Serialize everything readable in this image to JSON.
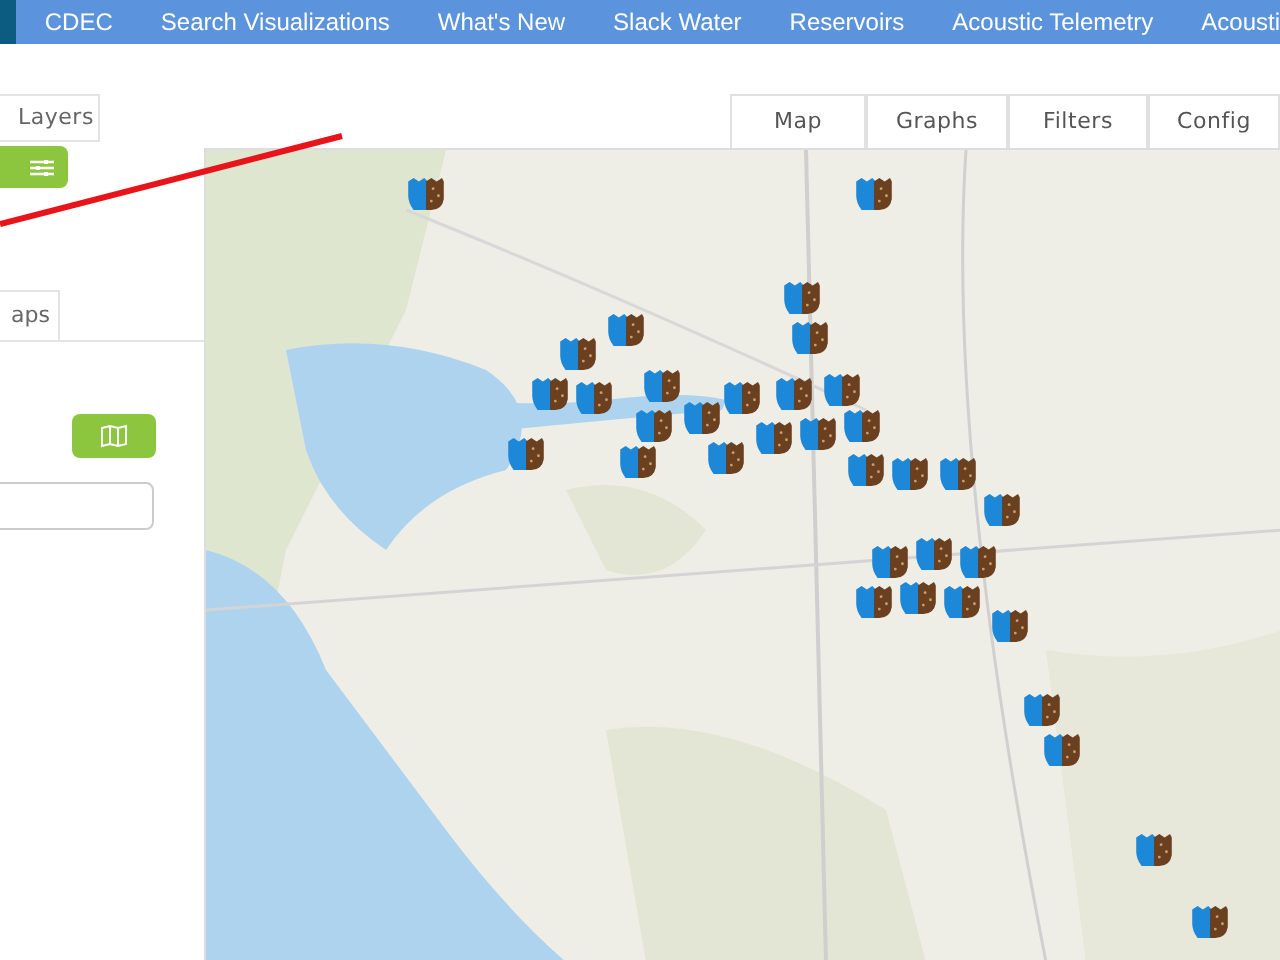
{
  "navbar": {
    "items": [
      "CDEC",
      "Search Visualizations",
      "What's New",
      "Slack Water",
      "Reservoirs",
      "Acoustic Telemetry",
      "Acousti"
    ]
  },
  "side_panel": {
    "tabs": [
      "Layers",
      "aps"
    ]
  },
  "map_tabs": [
    "Map",
    "Graphs",
    "Filters",
    "Config"
  ]
}
